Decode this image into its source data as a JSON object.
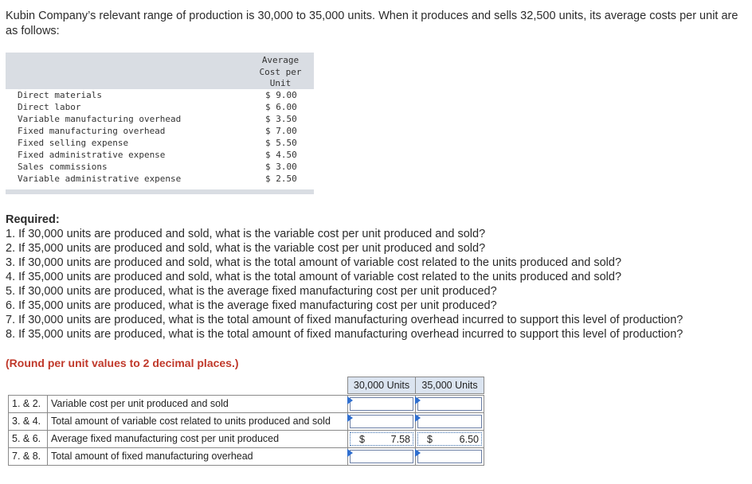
{
  "intro": "Kubin Company’s relevant range of production is 30,000 to 35,000 units. When it produces and sells 32,500 units, its average costs per unit are as follows:",
  "cost_table": {
    "header": [
      "Average",
      "Cost per",
      "Unit"
    ],
    "rows": [
      {
        "label": "Direct materials",
        "value": "$ 9.00"
      },
      {
        "label": "Direct labor",
        "value": "$ 6.00"
      },
      {
        "label": "Variable manufacturing overhead",
        "value": "$ 3.50"
      },
      {
        "label": "Fixed manufacturing overhead",
        "value": "$ 7.00"
      },
      {
        "label": "Fixed selling expense",
        "value": "$ 5.50"
      },
      {
        "label": "Fixed administrative expense",
        "value": "$ 4.50"
      },
      {
        "label": "Sales commissions",
        "value": "$ 3.00"
      },
      {
        "label": "Variable administrative expense",
        "value": "$ 2.50"
      }
    ]
  },
  "required": {
    "title": "Required:",
    "items": [
      "1. If 30,000 units are produced and sold, what is the variable cost per unit produced and sold?",
      "2. If 35,000 units are produced and sold, what is the variable cost per unit produced and sold?",
      "3. If 30,000 units are produced and sold, what is the total amount of variable cost related to the units produced and sold?",
      "4. If 35,000 units are produced and sold, what is the total amount of variable cost related to the units produced and sold?",
      "5. If 30,000 units are produced, what is the average fixed manufacturing cost per unit produced?",
      "6. If 35,000 units are produced, what is the average fixed manufacturing cost per unit produced?",
      "7. If 30,000 units are produced, what is the total amount of fixed manufacturing overhead incurred to support this level of production?",
      "8. If 35,000 units are produced, what is the total amount of fixed manufacturing overhead incurred to support this level of production?"
    ]
  },
  "round_note": "(Round per unit values to 2 decimal places.)",
  "answer_table": {
    "col1": "30,000 Units",
    "col2": "35,000 Units",
    "rows": [
      {
        "num": "1. & 2.",
        "desc": "Variable cost per unit produced and sold",
        "c1_cur": "",
        "c1_val": "",
        "c2_cur": "",
        "c2_val": ""
      },
      {
        "num": "3. & 4.",
        "desc": "Total amount of variable cost related to units produced and sold",
        "c1_cur": "",
        "c1_val": "",
        "c2_cur": "",
        "c2_val": ""
      },
      {
        "num": "5. & 6.",
        "desc": "Average fixed manufacturing cost per unit produced",
        "c1_cur": "$",
        "c1_val": "7.58",
        "c2_cur": "$",
        "c2_val": "6.50"
      },
      {
        "num": "7. & 8.",
        "desc": "Total amount of fixed manufacturing overhead",
        "c1_cur": "",
        "c1_val": "",
        "c2_cur": "",
        "c2_val": ""
      }
    ]
  }
}
